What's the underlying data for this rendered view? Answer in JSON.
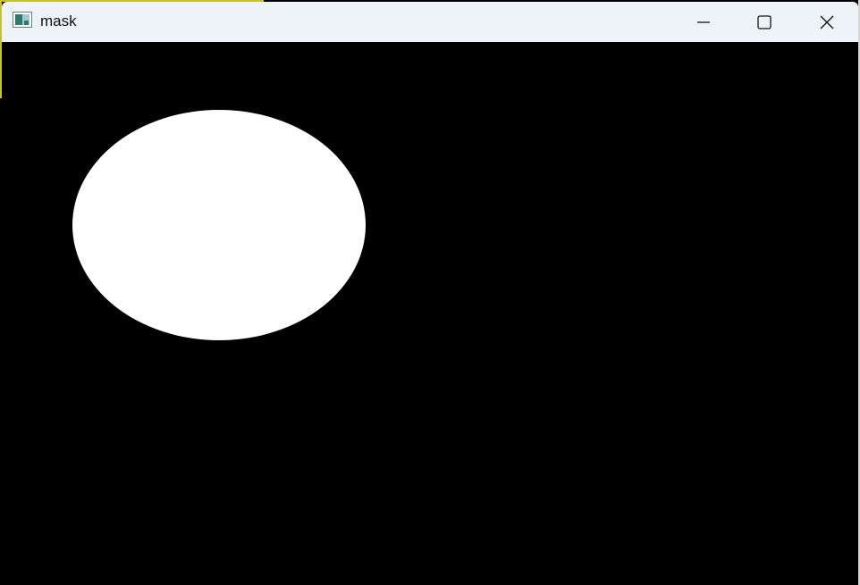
{
  "window": {
    "title": "mask",
    "app_icon": "image-window-icon",
    "controls": {
      "minimize": "minimize-icon",
      "maximize": "maximize-icon",
      "close": "close-icon"
    }
  },
  "canvas": {
    "background_color": "#000000",
    "shape": {
      "type": "ellipse",
      "fill_color": "#ffffff"
    }
  }
}
